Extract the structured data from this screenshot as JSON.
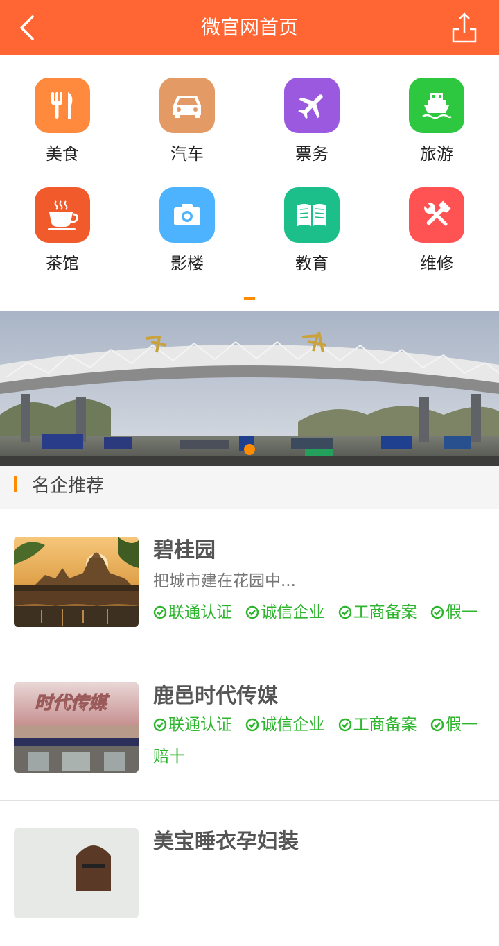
{
  "header": {
    "title": "微官网首页"
  },
  "categories": [
    {
      "label": "美食",
      "icon": "utensils-icon",
      "color": "#ff8a3d"
    },
    {
      "label": "汽车",
      "icon": "car-icon",
      "color": "#e39a64"
    },
    {
      "label": "票务",
      "icon": "airplane-icon",
      "color": "#9b59e0"
    },
    {
      "label": "旅游",
      "icon": "ship-icon",
      "color": "#2ec740"
    },
    {
      "label": "茶馆",
      "icon": "teacup-icon",
      "color": "#f15a2b"
    },
    {
      "label": "影楼",
      "icon": "camera-icon",
      "color": "#4db3ff"
    },
    {
      "label": "教育",
      "icon": "book-icon",
      "color": "#1cbf8a"
    },
    {
      "label": "维修",
      "icon": "tools-icon",
      "color": "#ff5252"
    }
  ],
  "section": {
    "title": "名企推荐"
  },
  "companies": [
    {
      "name": "碧桂园",
      "desc": "把城市建在花园中...",
      "tags": [
        "联通认证",
        "诚信企业",
        "工商备案",
        "假一"
      ]
    },
    {
      "name": "鹿邑时代传媒",
      "tags": [
        "联通认证",
        "诚信企业",
        "工商备案",
        "假一",
        "赔十"
      ],
      "thumb_text": "时代传媒"
    },
    {
      "name": "美宝睡衣孕妇装"
    }
  ],
  "colors": {
    "header": "#ff6633",
    "accent": "#ff8c00",
    "tag_green": "#2db52d"
  }
}
